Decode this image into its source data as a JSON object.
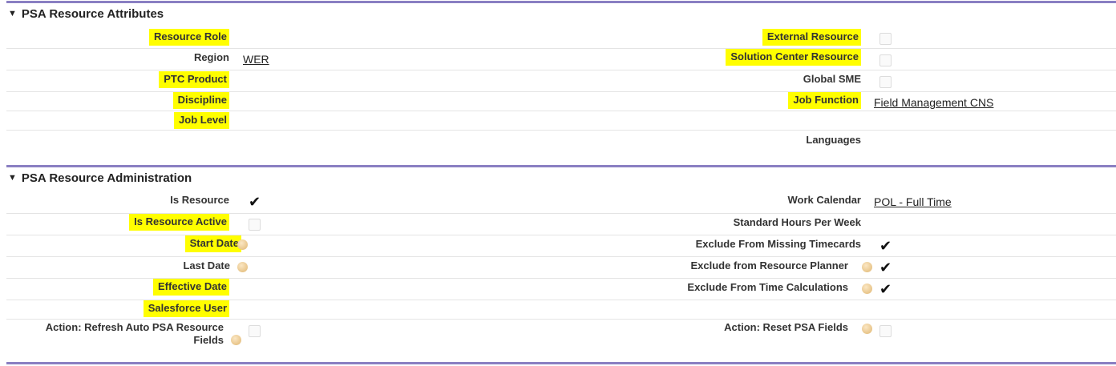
{
  "attributes": {
    "title": "PSA Resource Attributes",
    "resource_role": "Resource Role",
    "region_label": "Region",
    "region_value": "WER",
    "ptc_product": "PTC Product",
    "discipline": "Discipline",
    "job_level": "Job Level",
    "external_resource": "External Resource",
    "solution_center_resource": "Solution Center Resource",
    "global_sme": "Global SME",
    "job_function_label": "Job Function",
    "job_function_value": "Field Management CNS",
    "languages": "Languages"
  },
  "administration": {
    "title": "PSA Resource Administration",
    "is_resource": "Is Resource",
    "is_resource_active": "Is Resource Active",
    "start_date": "Start Date",
    "last_date": "Last Date",
    "effective_date": "Effective Date",
    "salesforce_user": "Salesforce User",
    "action_refresh": "Action: Refresh Auto PSA Resource Fields",
    "work_calendar_label": "Work Calendar",
    "work_calendar_value": "POL - Full Time",
    "standard_hours": "Standard Hours Per Week",
    "exclude_missing_timecards": "Exclude From Missing Timecards",
    "exclude_resource_planner": "Exclude from Resource Planner",
    "exclude_time_calculations": "Exclude From Time Calculations",
    "action_reset": "Action: Reset PSA Fields"
  },
  "checkboxes": {
    "external_resource": false,
    "solution_center_resource": false,
    "global_sme": false,
    "is_resource": true,
    "is_resource_active": false,
    "exclude_missing_timecards": true,
    "exclude_resource_planner": true,
    "exclude_time_calculations": true,
    "action_refresh": false,
    "action_reset": false
  },
  "icons": {
    "collapse": "triangle-down-icon",
    "help": "help-bubble-icon",
    "check": "checkmark-icon"
  },
  "colors": {
    "section_line": "#8a7fc2",
    "highlight": "#fffe00"
  }
}
